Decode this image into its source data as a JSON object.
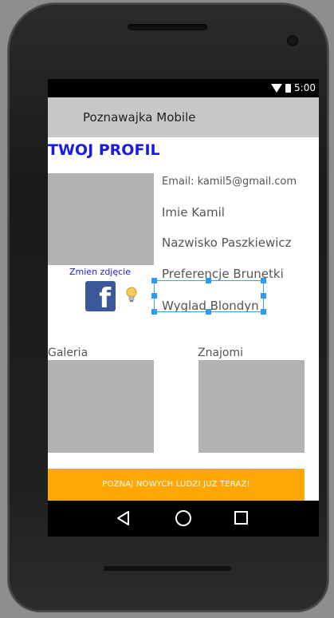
{
  "status": {
    "time": "5:00"
  },
  "app": {
    "title": "Poznawajka Mobile"
  },
  "profile": {
    "heading": "TWOJ PROFIL",
    "email": "Email: kamil5@gmail.com",
    "imie": "Imie Kamil",
    "nazwisko": "Nazwisko Paszkiewicz",
    "preferencje": "Preferencje Brunetki",
    "wyglad": "Wyglad Blondyn",
    "change_photo": "Zmien zdjęcie"
  },
  "sections": {
    "gallery": "Galeria",
    "friends": "Znajomi"
  },
  "cta": {
    "label": "POZNAJ NOWYCH LUDZI JUZ TERAZ!"
  },
  "icons": {
    "facebook": "facebook-icon",
    "bulb": "lightbulb-icon",
    "wifi": "wifi-icon",
    "battery": "battery-icon",
    "back": "back-icon",
    "home": "home-icon",
    "recents": "recents-icon"
  },
  "colors": {
    "accent": "#1a1ae6",
    "cta": "#ffa705",
    "placeholder": "#b3b1b1",
    "app_bar": "#c8c8c8",
    "selection": "#2d9cf0",
    "facebook": "#3b5998"
  }
}
